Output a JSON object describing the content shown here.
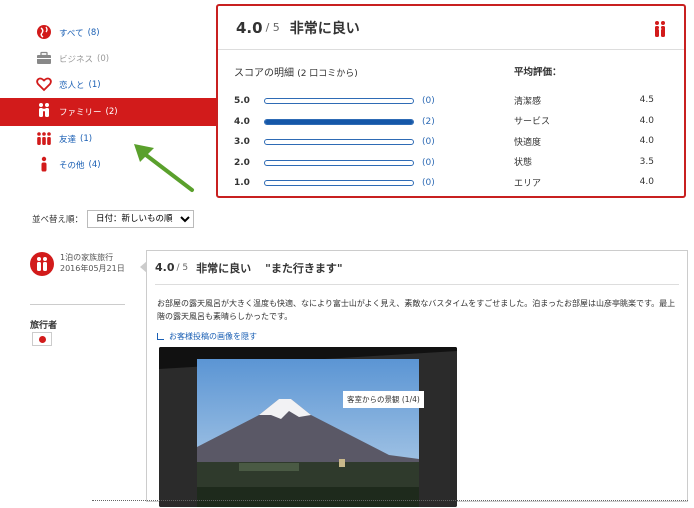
{
  "filters": [
    {
      "label": "すべて",
      "count": "(8)",
      "icon": "globe-icon",
      "state": "normal"
    },
    {
      "label": "ビジネス",
      "count": "(0)",
      "icon": "briefcase-icon",
      "state": "disabled"
    },
    {
      "label": "恋人と",
      "count": "(1)",
      "icon": "heart-icon",
      "state": "normal"
    },
    {
      "label": "ファミリー",
      "count": "(2)",
      "icon": "family-icon",
      "state": "active"
    },
    {
      "label": "友達",
      "count": "(1)",
      "icon": "friends-icon",
      "state": "normal"
    },
    {
      "label": "その他",
      "count": "(4)",
      "icon": "person-icon",
      "state": "normal"
    }
  ],
  "summary": {
    "score": "4.0",
    "outof": "/ 5",
    "verdict": "非常に良い",
    "breakdown_title": "スコアの明細",
    "breakdown_sub": "(2 口コミから)",
    "rows": [
      {
        "label": "5.0",
        "count": "(0)",
        "fill": 0
      },
      {
        "label": "4.0",
        "count": "(2)",
        "fill": 1
      },
      {
        "label": "3.0",
        "count": "(0)",
        "fill": 0
      },
      {
        "label": "2.0",
        "count": "(0)",
        "fill": 0
      },
      {
        "label": "1.0",
        "count": "(0)",
        "fill": 0
      }
    ],
    "averages_title": "平均評価：",
    "averages": [
      {
        "label": "清潔感",
        "value": "4.5"
      },
      {
        "label": "サービス",
        "value": "4.0"
      },
      {
        "label": "快適度",
        "value": "4.0"
      },
      {
        "label": "状態",
        "value": "3.5"
      },
      {
        "label": "エリア",
        "value": "4.0"
      }
    ]
  },
  "sort": {
    "label": "並べ替え順：",
    "selected": "日付：新しいもの順"
  },
  "review": {
    "trip": "1泊の家族旅行",
    "date": "2016年05月21日",
    "traveler_label": "旅行者",
    "score": "4.0",
    "outof": "/ 5",
    "verdict": "非常に良い",
    "title": "\"また行きます\"",
    "body": "お部屋の露天風呂が大きく温度も快適、なにより富士山がよく見え、素敵なバスタイムをすごせました。泊まったお部屋は山彦亭眺楽です。最上階の露天風呂も素晴らしかったです。",
    "toggle_link": "お客様投稿の画像を隠す",
    "photo_caption": "客室からの景観 (1/4)"
  },
  "colors": {
    "accent": "#d21b1b",
    "link": "#1a5fb4",
    "arrow": "#5aa02c"
  }
}
